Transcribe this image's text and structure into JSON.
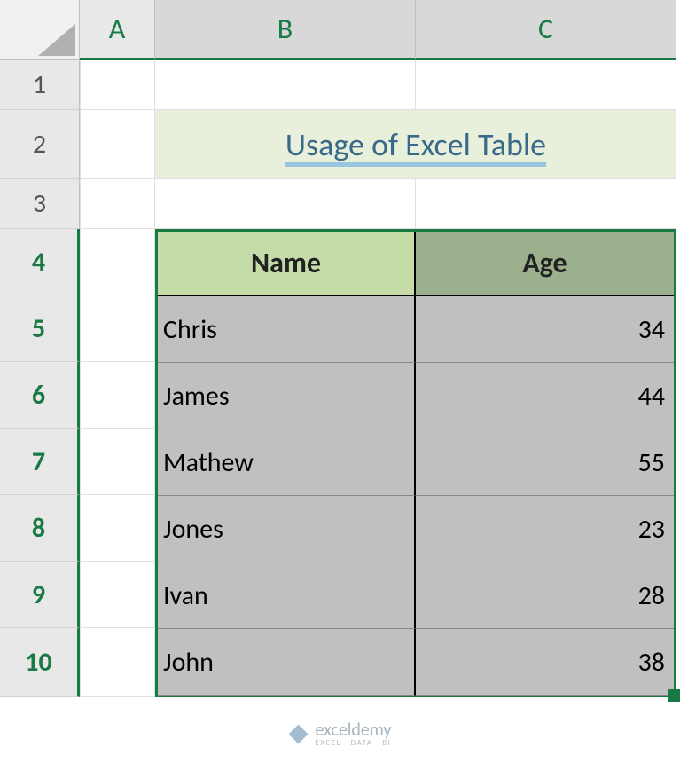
{
  "columns": [
    "A",
    "B",
    "C"
  ],
  "rows": [
    "1",
    "2",
    "3",
    "4",
    "5",
    "6",
    "7",
    "8",
    "9",
    "10"
  ],
  "title": "Usage of Excel Table",
  "table": {
    "headers": {
      "name": "Name",
      "age": "Age"
    },
    "data": [
      {
        "name": "Chris",
        "age": "34"
      },
      {
        "name": "James",
        "age": "44"
      },
      {
        "name": "Mathew",
        "age": "55"
      },
      {
        "name": "Jones",
        "age": "23"
      },
      {
        "name": "Ivan",
        "age": "28"
      },
      {
        "name": "John",
        "age": "38"
      }
    ]
  },
  "watermark": {
    "name": "exceldemy",
    "tagline": "EXCEL · DATA · BI"
  },
  "chart_data": {
    "type": "table",
    "title": "Usage of Excel Table",
    "columns": [
      "Name",
      "Age"
    ],
    "rows": [
      [
        "Chris",
        34
      ],
      [
        "James",
        44
      ],
      [
        "Mathew",
        55
      ],
      [
        "Jones",
        23
      ],
      [
        "Ivan",
        28
      ],
      [
        "John",
        38
      ]
    ]
  }
}
